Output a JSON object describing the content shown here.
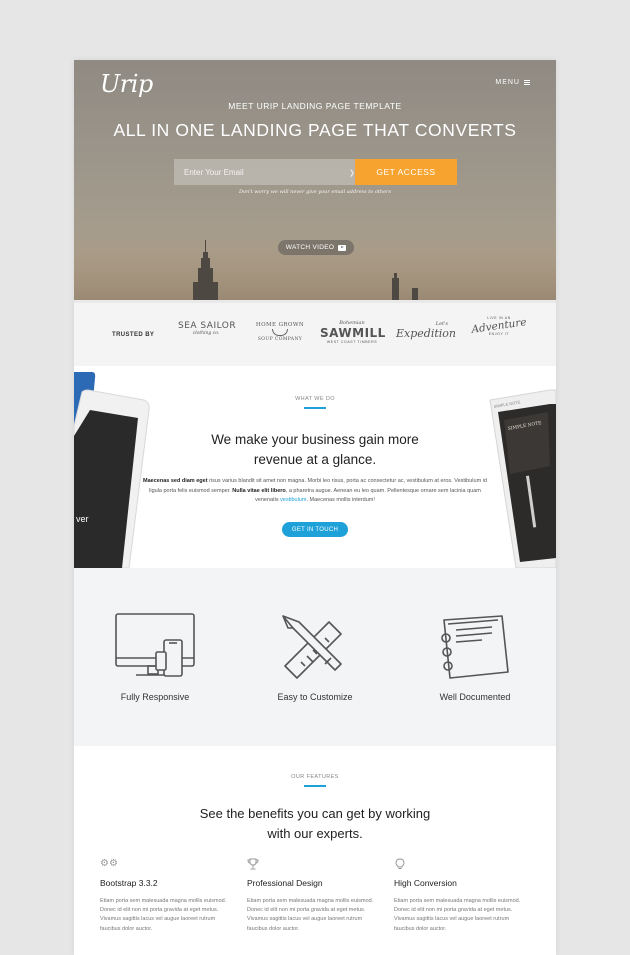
{
  "header": {
    "logo": "Urip",
    "menu_label": "MENU"
  },
  "hero": {
    "kicker": "MEET URIP LANDING PAGE TEMPLATE",
    "title": "ALL IN ONE LANDING PAGE THAT CONVERTS",
    "email_placeholder": "Enter Your Email",
    "cta_label": "GET ACCESS",
    "note": "Don't worry we will never give your email address to others",
    "watch_label": "WATCH VIDEO",
    "cta_color": "#f6a330"
  },
  "trusted": {
    "label": "TRUSTED BY",
    "brands": [
      {
        "line1": "SEA SAILOR",
        "line2": "clothing co."
      },
      {
        "line1": "HOME GROWN",
        "line2": "SOUP COMPANY"
      },
      {
        "line1": "Bohemian",
        "line2": "SAWMILL",
        "line3": "WEST COAST TIMBERS"
      },
      {
        "line1": "Let's",
        "line2": "Expedition"
      },
      {
        "line1": "LIVE IN AN",
        "line2": "Adventure",
        "line3": "ENJOY IT"
      }
    ]
  },
  "what_we_do": {
    "kicker": "WHAT WE DO",
    "title_line1": "We make your business gain more",
    "title_line2": "revenue at a glance.",
    "body_bold1": "Maecenas sed diam eget",
    "body_text1": " risus varius blandit sit amet non magna. Morbi leo risus, porta ac consectetur ac, vestibulum at eros. Vestibulum id ligula porta felis euismod semper. ",
    "body_bold2": "Nulla vitae elit libero",
    "body_text2": ", a pharetra augue. Aenean eu leo quam. Pellentesque ornare sem lacinia quam venenatis ",
    "body_link": "vestibulum",
    "body_text3": ". Maecenas mollis interdum!",
    "cta_label": "GET IN TOUCH",
    "accent": "#1ea1d8",
    "tablet_left_text": "ver",
    "tablet_right_text_1": "SIMPLE NOTE",
    "tablet_right_text_2": "SIMPLE NOTE"
  },
  "benefits": [
    {
      "icon": "monitor-devices-icon",
      "label": "Fully Responsive"
    },
    {
      "icon": "pencil-ruler-icon",
      "label": "Easy to Customize"
    },
    {
      "icon": "notebook-icon",
      "label": "Well Documented"
    }
  ],
  "our_features": {
    "kicker": "OUR FEATURES",
    "title_line1": "See the benefits you can get by working",
    "title_line2": "with our experts.",
    "columns": [
      {
        "icon": "gears-icon",
        "title": "Bootstrap 3.3.2",
        "body": "Etiam porta sem malesuada magna mollis euismod. Donec id elit non mi porta gravida at eget metus. Vivamus sagittis lacus vel augue laoreet rutrum faucibus dolor auctor."
      },
      {
        "icon": "trophy-icon",
        "title": "Professional Design",
        "body": "Etiam porta sem malesuada magna mollis euismod. Donec id elit non mi porta gravida at eget metus. Vivamus sagittis lacus vel augue laoreet rutrum faucibus dolor auctor."
      },
      {
        "icon": "lightbulb-icon",
        "title": "High Conversion",
        "body": "Etiam porta sem malesuada magna mollis euismod. Donec id elit non mi porta gravida at eget metus. Vivamus sagittis lacus vel augue laoreet rutrum faucibus dolor auctor."
      }
    ]
  }
}
